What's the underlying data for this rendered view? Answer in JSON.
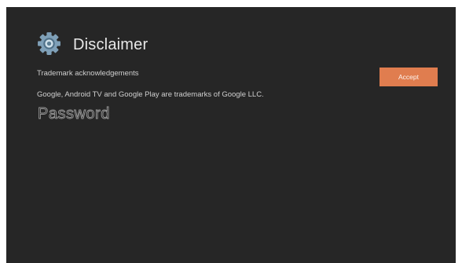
{
  "header": {
    "icon": "gear-icon",
    "title": "Disclaimer"
  },
  "content": {
    "line1": "Trademark acknowledgements",
    "line2": "Google, Android TV and Google Play are trademarks of Google LLC.",
    "password_label": "Password"
  },
  "actions": {
    "accept_label": "Accept"
  },
  "colors": {
    "background": "#262626",
    "accent": "#e07d4f",
    "icon": "#7fa0b8"
  }
}
